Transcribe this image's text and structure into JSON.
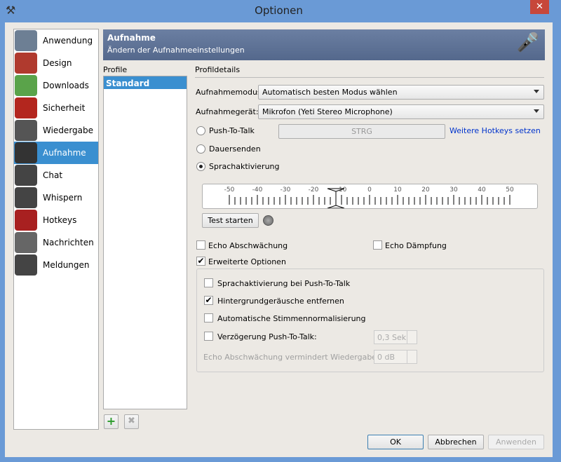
{
  "window": {
    "title": "Optionen",
    "close_label": "✕"
  },
  "sidebar": {
    "items": [
      {
        "label": "Anwendung",
        "icon": "teamspeak-logo-icon",
        "color": "#6d7f94"
      },
      {
        "label": "Design",
        "icon": "design-palette-icon",
        "color": "#b03a2e"
      },
      {
        "label": "Downloads",
        "icon": "downloads-icon",
        "color": "#5aa34a"
      },
      {
        "label": "Sicherheit",
        "icon": "lock-shield-icon",
        "color": "#b3261e"
      },
      {
        "label": "Wiedergabe",
        "icon": "speaker-icon",
        "color": "#555"
      },
      {
        "label": "Aufnahme",
        "icon": "microphone-icon",
        "color": "#333",
        "selected": true
      },
      {
        "label": "Chat",
        "icon": "chat-bubble-icon",
        "color": "#444"
      },
      {
        "label": "Whispern",
        "icon": "headset-icon",
        "color": "#444"
      },
      {
        "label": "Hotkeys",
        "icon": "hotkeys-icon",
        "color": "#a82020"
      },
      {
        "label": "Nachrichten",
        "icon": "messages-icon",
        "color": "#666"
      },
      {
        "label": "Meldungen",
        "icon": "notifications-icon",
        "color": "#444"
      }
    ]
  },
  "banner": {
    "title": "Aufnahme",
    "subtitle": "Ändern der Aufnahmeeinstellungen"
  },
  "profiles": {
    "header": "Profile",
    "items": [
      "Standard"
    ],
    "add_label": "+",
    "remove_label": "✖"
  },
  "details": {
    "header": "Profildetails",
    "mode_label": "Aufnahmemodus:",
    "mode_value": "Automatisch besten Modus wählen",
    "device_label": "Aufnahmegerät:",
    "device_value": "Mikrofon (Yeti Stereo Microphone)",
    "ptt_label": "Push-To-Talk",
    "ptt_key": "STRG",
    "hotkeys_link": "Weitere Hotkeys setzen",
    "continuous_label": "Dauersenden",
    "vad_label": "Sprachaktivierung",
    "transmit_mode": "Sprachaktivierung",
    "meter": {
      "ticks": [
        "-50",
        "-40",
        "-30",
        "-20",
        "-10",
        "0",
        "10",
        "20",
        "30",
        "40",
        "50"
      ],
      "threshold": -12
    },
    "test_button": "Test starten",
    "echo_reduction": {
      "label": "Echo Abschwächung",
      "checked": false
    },
    "echo_cancel": {
      "label": "Echo Dämpfung",
      "checked": false
    },
    "advanced": {
      "label": "Erweiterte Optionen",
      "checked": true
    },
    "adv": {
      "vad_ptt": {
        "label": "Sprachaktivierung bei Push-To-Talk",
        "checked": false
      },
      "denoise": {
        "label": "Hintergrundgeräusche entfernen",
        "checked": true
      },
      "agc": {
        "label": "Automatische Stimmennormalisierung",
        "checked": false
      },
      "ptt_delay": {
        "label": "Verzögerung Push-To-Talk:",
        "checked": false,
        "value": "0,3 Sek"
      },
      "echo_attn": {
        "label": "Echo Abschwächung vermindert Wiedergabe um:",
        "value": "0 dB"
      }
    }
  },
  "footer": {
    "ok": "OK",
    "cancel": "Abbrechen",
    "apply": "Anwenden"
  }
}
